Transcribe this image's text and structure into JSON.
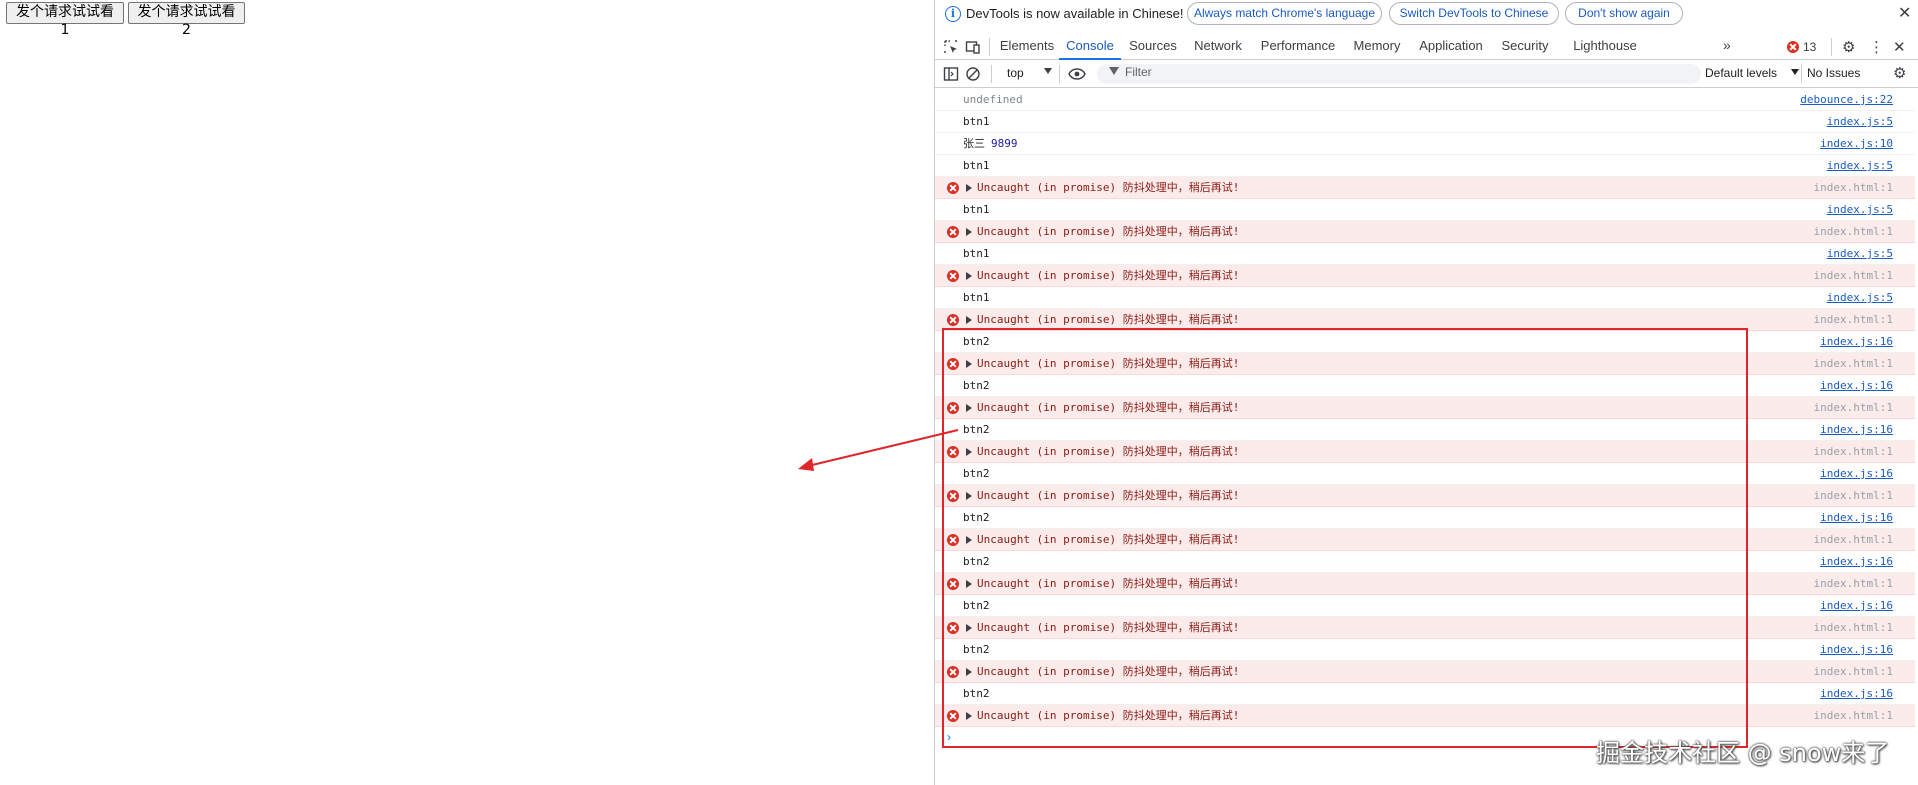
{
  "page": {
    "buttons": [
      "发个请求试试看1",
      "发个请求试试看2"
    ]
  },
  "devtools": {
    "infobar": {
      "text": "DevTools is now available in Chinese!",
      "buttons": [
        "Always match Chrome's language",
        "Switch DevTools to Chinese",
        "Don't show again"
      ]
    },
    "tabs": [
      "Elements",
      "Console",
      "Sources",
      "Network",
      "Performance",
      "Memory",
      "Application",
      "Security",
      "Lighthouse"
    ],
    "active_tab": "Console",
    "error_count": "13",
    "context": "top",
    "filter_placeholder": "Filter",
    "levels": "Default levels",
    "issues": "No Issues"
  },
  "console": {
    "rows": [
      {
        "type": "log",
        "msg": "undefined",
        "src": "debounce.js:22",
        "muted": true
      },
      {
        "type": "log",
        "msg": "btn1",
        "src": "index.js:5"
      },
      {
        "type": "log",
        "msg": "张三",
        "num": "9899",
        "src": "index.js:10"
      },
      {
        "type": "log",
        "msg": "btn1",
        "src": "index.js:5"
      },
      {
        "type": "error",
        "msg": "Uncaught (in promise) 防抖处理中，稍后再试!",
        "src": "index.html:1"
      },
      {
        "type": "log",
        "msg": "btn1",
        "src": "index.js:5"
      },
      {
        "type": "error",
        "msg": "Uncaught (in promise) 防抖处理中，稍后再试!",
        "src": "index.html:1"
      },
      {
        "type": "log",
        "msg": "btn1",
        "src": "index.js:5"
      },
      {
        "type": "error",
        "msg": "Uncaught (in promise) 防抖处理中，稍后再试!",
        "src": "index.html:1"
      },
      {
        "type": "log",
        "msg": "btn1",
        "src": "index.js:5"
      },
      {
        "type": "error",
        "msg": "Uncaught (in promise) 防抖处理中，稍后再试!",
        "src": "index.html:1"
      },
      {
        "type": "log",
        "msg": "btn2",
        "src": "index.js:16"
      },
      {
        "type": "error",
        "msg": "Uncaught (in promise) 防抖处理中，稍后再试!",
        "src": "index.html:1"
      },
      {
        "type": "log",
        "msg": "btn2",
        "src": "index.js:16"
      },
      {
        "type": "error",
        "msg": "Uncaught (in promise) 防抖处理中，稍后再试!",
        "src": "index.html:1"
      },
      {
        "type": "log",
        "msg": "btn2",
        "src": "index.js:16"
      },
      {
        "type": "error",
        "msg": "Uncaught (in promise) 防抖处理中，稍后再试!",
        "src": "index.html:1"
      },
      {
        "type": "log",
        "msg": "btn2",
        "src": "index.js:16"
      },
      {
        "type": "error",
        "msg": "Uncaught (in promise) 防抖处理中，稍后再试!",
        "src": "index.html:1"
      },
      {
        "type": "log",
        "msg": "btn2",
        "src": "index.js:16"
      },
      {
        "type": "error",
        "msg": "Uncaught (in promise) 防抖处理中，稍后再试!",
        "src": "index.html:1"
      },
      {
        "type": "log",
        "msg": "btn2",
        "src": "index.js:16"
      },
      {
        "type": "error",
        "msg": "Uncaught (in promise) 防抖处理中，稍后再试!",
        "src": "index.html:1"
      },
      {
        "type": "log",
        "msg": "btn2",
        "src": "index.js:16"
      },
      {
        "type": "error",
        "msg": "Uncaught (in promise) 防抖处理中，稍后再试!",
        "src": "index.html:1"
      },
      {
        "type": "log",
        "msg": "btn2",
        "src": "index.js:16"
      },
      {
        "type": "error",
        "msg": "Uncaught (in promise) 防抖处理中，稍后再试!",
        "src": "index.html:1"
      },
      {
        "type": "log",
        "msg": "btn2",
        "src": "index.js:16"
      },
      {
        "type": "error",
        "msg": "Uncaught (in promise) 防抖处理中，稍后再试!",
        "src": "index.html:1"
      }
    ],
    "prompt": "›"
  },
  "annotation": {
    "color": "#e0262b"
  },
  "watermark": "掘金技术社区 @ snow来了"
}
